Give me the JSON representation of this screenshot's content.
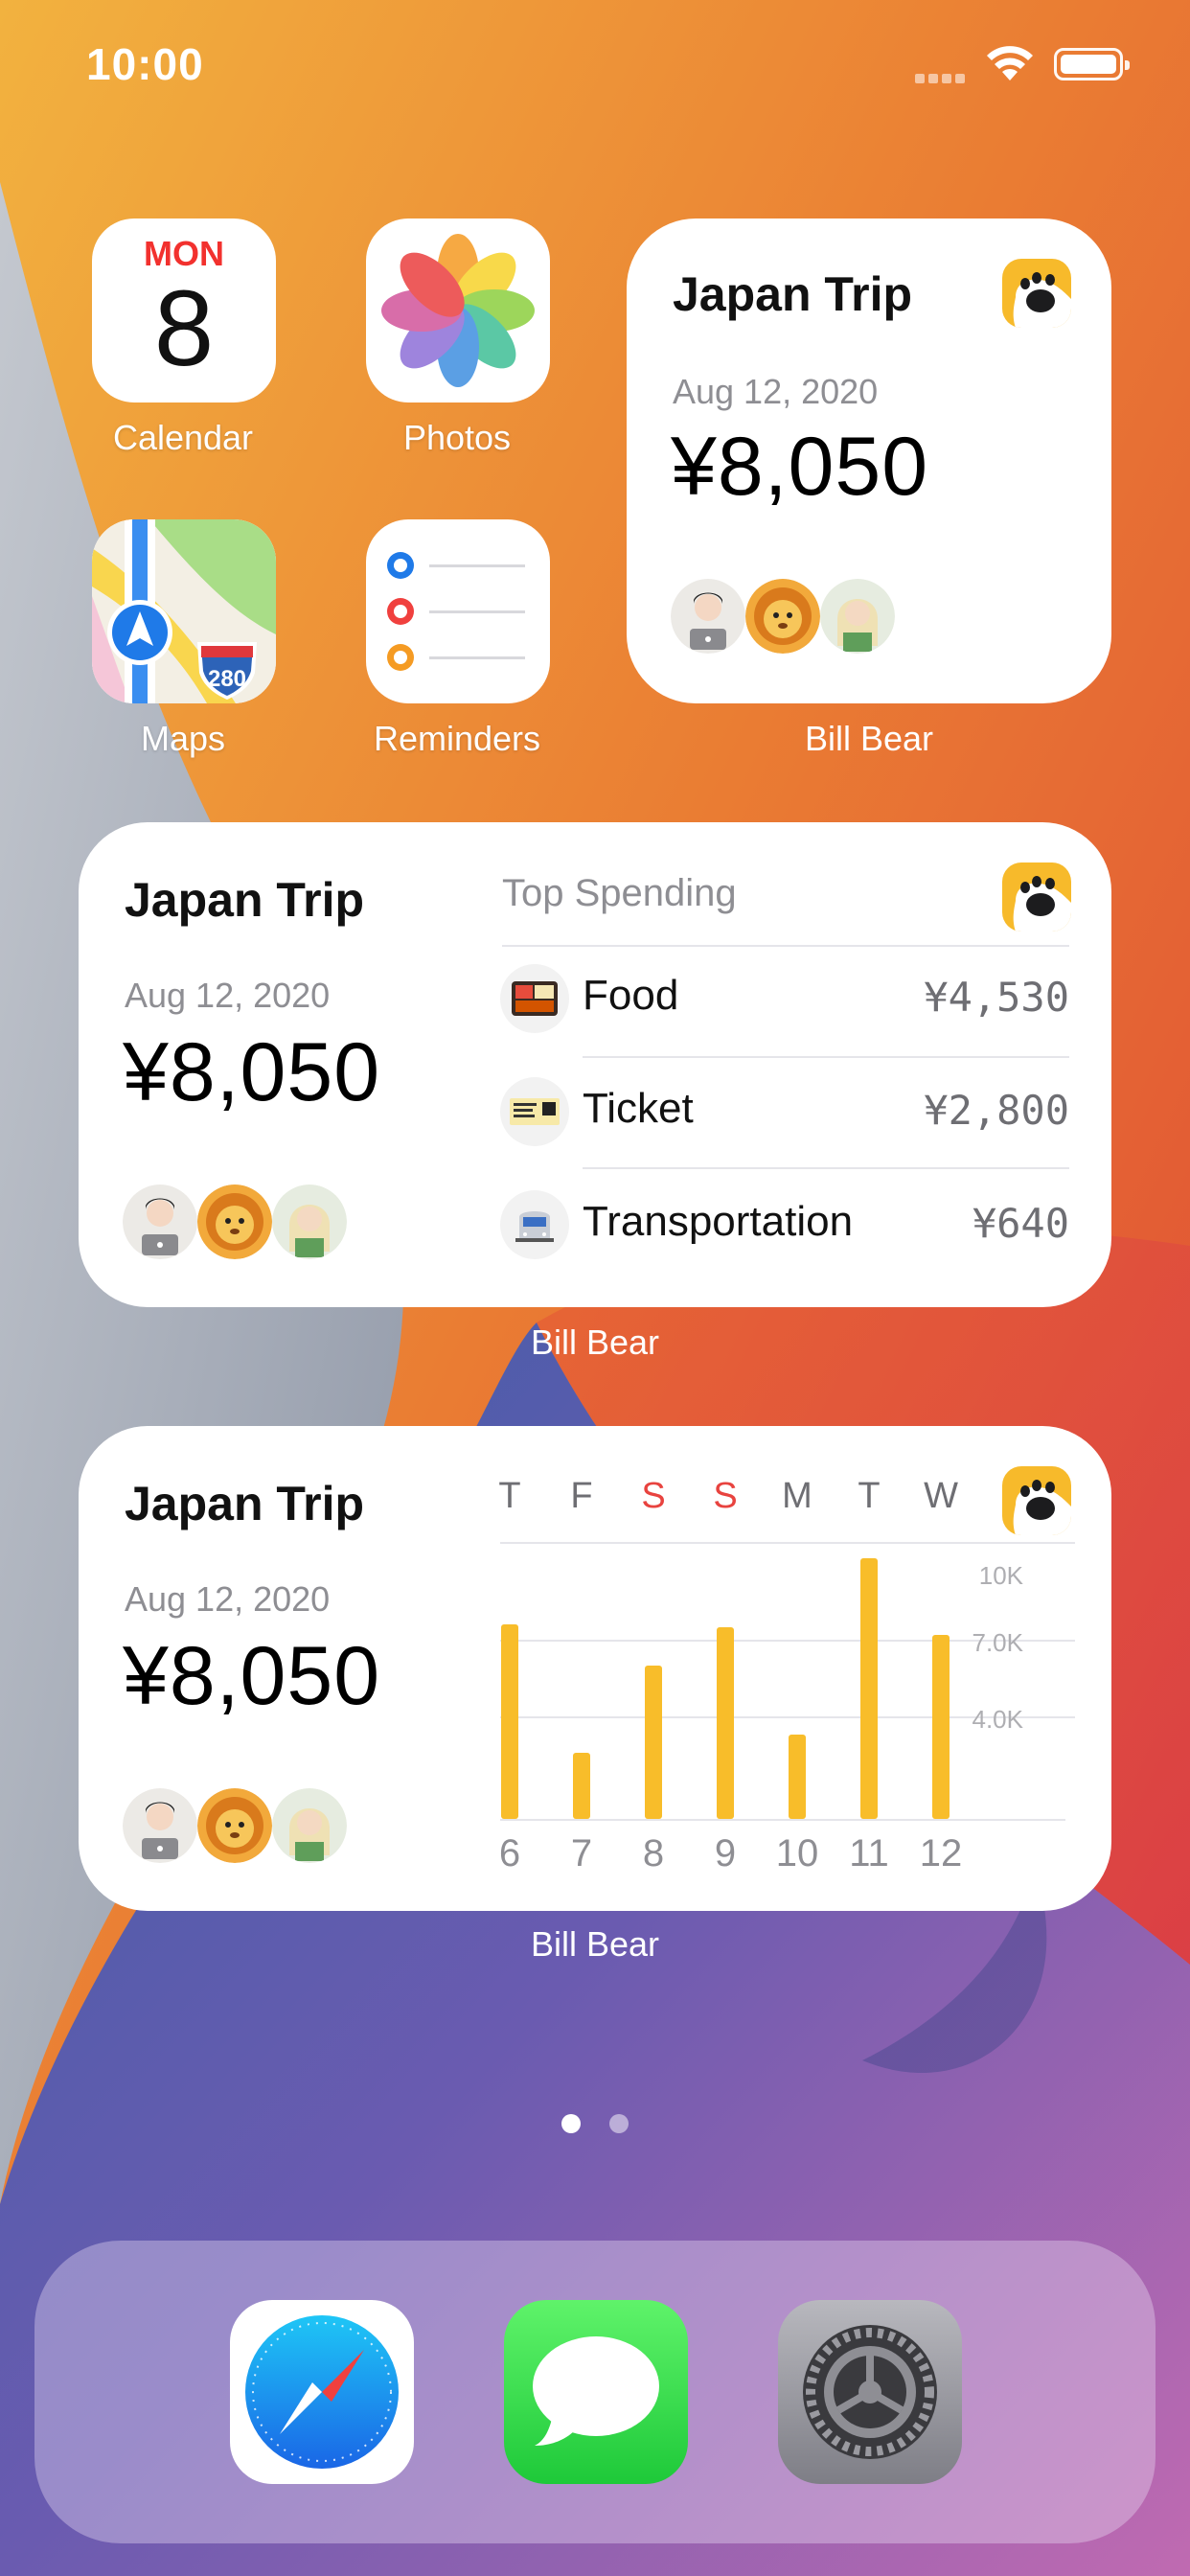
{
  "status_bar": {
    "time": "10:00",
    "signal_icon": "cellular-signal-icon",
    "wifi_icon": "wifi-icon",
    "battery_icon": "battery-icon"
  },
  "apps": {
    "calendar": {
      "label": "Calendar",
      "day": "MON",
      "date": "8",
      "icon": "calendar-icon"
    },
    "photos": {
      "label": "Photos",
      "icon": "photos-icon"
    },
    "maps": {
      "label": "Maps",
      "icon": "maps-icon",
      "route_sign": "280"
    },
    "reminders": {
      "label": "Reminders",
      "icon": "reminders-icon"
    }
  },
  "widgets": {
    "small": {
      "title": "Japan Trip",
      "date": "Aug 12, 2020",
      "amount": "¥8,050",
      "app_label": "Bill Bear",
      "logo_icon": "bill-bear-paw-icon",
      "avatars": [
        "man-with-laptop-avatar",
        "lion-avatar",
        "elf-avatar"
      ]
    },
    "medium_spending": {
      "title": "Japan Trip",
      "date": "Aug 12, 2020",
      "amount": "¥8,050",
      "app_label": "Bill Bear",
      "top_spending_header": "Top Spending",
      "items": [
        {
          "name": "Food",
          "amount": "¥4,530",
          "icon": "bento-box-icon"
        },
        {
          "name": "Ticket",
          "amount": "¥2,800",
          "icon": "ticket-icon"
        },
        {
          "name": "Transportation",
          "amount": "¥640",
          "icon": "train-icon"
        }
      ]
    },
    "medium_chart": {
      "title": "Japan Trip",
      "date": "Aug 12, 2020",
      "amount": "¥8,050",
      "app_label": "Bill Bear"
    }
  },
  "chart_data": {
    "type": "bar",
    "categories": [
      "6",
      "7",
      "8",
      "9",
      "10",
      "11",
      "12"
    ],
    "weekday_letters": [
      "T",
      "F",
      "S",
      "S",
      "M",
      "T",
      "W"
    ],
    "weekend_flags": [
      false,
      false,
      true,
      true,
      false,
      false,
      false
    ],
    "values": [
      7600,
      2600,
      6000,
      7500,
      3300,
      10200,
      7200
    ],
    "tick_labels": [
      "10K",
      "7.0K",
      "4.0K"
    ],
    "ticks": [
      10000,
      7000,
      4000
    ],
    "ylim": [
      0,
      10500
    ],
    "bar_color": "#f8bd2a",
    "weekend_color": "#e8433f",
    "grid": true
  },
  "page_indicator": {
    "count": 2,
    "active": 0
  },
  "dock": {
    "apps": [
      {
        "icon": "safari-icon"
      },
      {
        "icon": "messages-icon"
      },
      {
        "icon": "settings-icon"
      }
    ]
  }
}
